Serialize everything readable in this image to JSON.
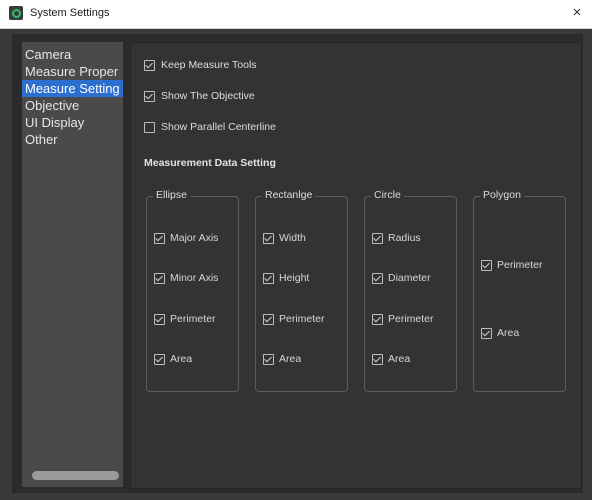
{
  "window": {
    "title": "System Settings",
    "close_glyph": "×"
  },
  "sidebar": {
    "items": [
      {
        "label": "Camera"
      },
      {
        "label": "Measure Proper"
      },
      {
        "label": "Measure Setting"
      },
      {
        "label": "Objective"
      },
      {
        "label": "UI Display"
      },
      {
        "label": "Other"
      }
    ],
    "selected": "Measure Setting"
  },
  "options": [
    {
      "label": "Keep Measure Tools",
      "checked": true
    },
    {
      "label": "Show The Objective",
      "checked": true
    },
    {
      "label": "Show Parallel Centerline",
      "checked": false
    }
  ],
  "measurement": {
    "title": "Measurement Data Setting",
    "groups": [
      {
        "title": "Ellipse",
        "items": [
          {
            "label": "Major Axis",
            "checked": true
          },
          {
            "label": "Minor Axis",
            "checked": true
          },
          {
            "label": "Perimeter",
            "checked": true
          },
          {
            "label": "Area",
            "checked": true
          }
        ]
      },
      {
        "title": "Rectanlge",
        "items": [
          {
            "label": "Width",
            "checked": true
          },
          {
            "label": "Height",
            "checked": true
          },
          {
            "label": "Perimeter",
            "checked": true
          },
          {
            "label": "Area",
            "checked": true
          }
        ]
      },
      {
        "title": "Circle",
        "items": [
          {
            "label": "Radius",
            "checked": true
          },
          {
            "label": "Diameter",
            "checked": true
          },
          {
            "label": "Perimeter",
            "checked": true
          },
          {
            "label": "Area",
            "checked": true
          }
        ]
      },
      {
        "title": "Polygon",
        "items": [
          {
            "label": "Perimeter",
            "checked": true
          },
          {
            "label": "Area",
            "checked": true
          }
        ]
      }
    ]
  },
  "colors": {
    "accent": "#2d6fd1",
    "background": "#2b2b2b",
    "sidebar": "#4a4a4a",
    "panel": "#333333"
  },
  "icons": {
    "app": "app-logo-icon",
    "close": "close-icon",
    "check": "checkbox-check-icon"
  }
}
